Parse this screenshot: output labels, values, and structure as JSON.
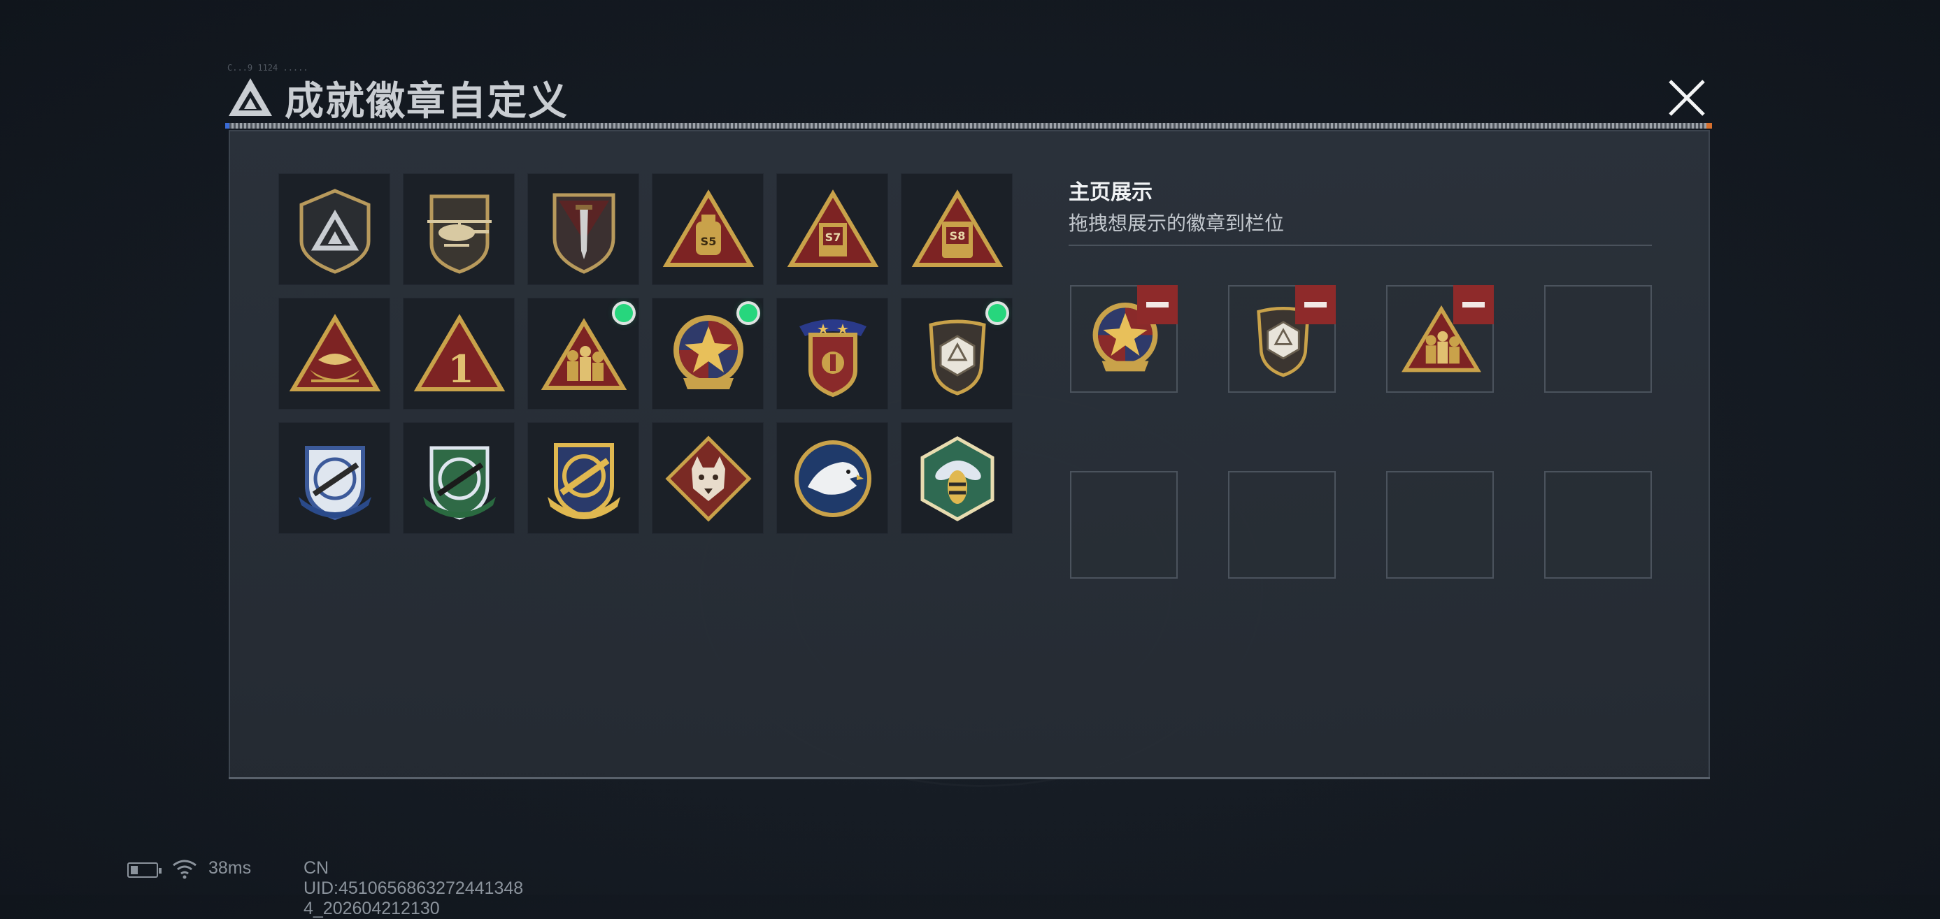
{
  "header": {
    "title": "成就徽章自定义",
    "tiny_caption": "C...9 1124 ....."
  },
  "showcase": {
    "title": "主页展示",
    "subtitle": "拖拽想展示的徽章到栏位"
  },
  "badges": [
    {
      "icon": "triangle-logo-shield-badge-icon",
      "new": false
    },
    {
      "icon": "helicopter-shield-badge-icon",
      "new": false
    },
    {
      "icon": "dagger-shield-badge-icon",
      "new": false
    },
    {
      "icon": "s5-triangle-badge-icon",
      "new": false,
      "text": "S5"
    },
    {
      "icon": "s7-triangle-badge-icon",
      "new": false,
      "text": "S7"
    },
    {
      "icon": "s8-triangle-badge-icon",
      "new": false,
      "text": "S8"
    },
    {
      "icon": "boat-triangle-badge-icon",
      "new": false
    },
    {
      "icon": "number-one-triangle-badge-icon",
      "new": false,
      "text": "1"
    },
    {
      "icon": "soldiers-triangle-badge-icon",
      "new": true
    },
    {
      "icon": "star-roundel-badge-icon",
      "new": true
    },
    {
      "icon": "stars-shield-badge-icon",
      "new": false
    },
    {
      "icon": "dice-shield-badge-icon",
      "new": true
    },
    {
      "icon": "blue-rifle-crosshair-badge-icon",
      "new": false
    },
    {
      "icon": "green-rifle-crosshair-badge-icon",
      "new": false
    },
    {
      "icon": "gold-rifle-crosshair-badge-icon",
      "new": false
    },
    {
      "icon": "wolf-diamond-badge-icon",
      "new": false
    },
    {
      "icon": "eagle-roundel-badge-icon",
      "new": false
    },
    {
      "icon": "hornet-hexagon-badge-icon",
      "new": false
    }
  ],
  "slots": [
    {
      "badge": "star-roundel-badge-icon",
      "removable": true
    },
    {
      "badge": "dice-shield-badge-icon",
      "removable": true
    },
    {
      "badge": "soldiers-triangle-badge-icon",
      "removable": true
    },
    {
      "badge": null,
      "removable": false
    },
    {
      "badge": null,
      "removable": false
    },
    {
      "badge": null,
      "removable": false
    },
    {
      "badge": null,
      "removable": false
    },
    {
      "badge": null,
      "removable": false
    }
  ],
  "status_bar": {
    "ping": "38ms",
    "uid": "CN UID:4510656863272441348​4_202604212130"
  },
  "colors": {
    "gold": "#c9a24a",
    "dark_red": "#7d2323",
    "new_dot": "#27d67d",
    "remove_button": "#8e2a2a"
  }
}
